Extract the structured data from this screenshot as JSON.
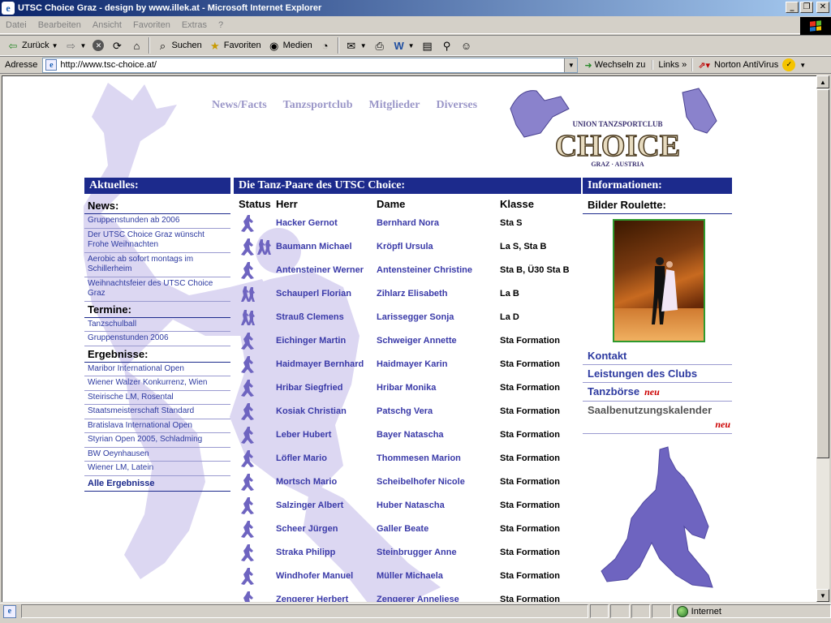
{
  "window": {
    "title": "UTSC Choice Graz - design by www.illek.at - Microsoft Internet Explorer",
    "minimize": "_",
    "restore": "❐",
    "close": "✕"
  },
  "menu": [
    "Datei",
    "Bearbeiten",
    "Ansicht",
    "Favoriten",
    "Extras",
    "?"
  ],
  "toolbar": {
    "back": "Zurück",
    "search": "Suchen",
    "favorites": "Favoriten",
    "media": "Medien"
  },
  "address": {
    "label": "Adresse",
    "url": "http://www.tsc-choice.at/",
    "go": "Wechseln zu",
    "links": "Links",
    "norton": "Norton AntiVirus"
  },
  "site": {
    "nav": [
      "News/Facts",
      "Tanzsportclub",
      "Mitglieder",
      "Diverses"
    ],
    "logo": {
      "top": "UNION TANZSPORTCLUB",
      "main": "CHOICE",
      "bottom": "GRAZ · AUSTRIA"
    },
    "left": {
      "heading": "Aktuelles:",
      "news_title": "News:",
      "news": [
        "Gruppenstunden ab 2006",
        "Der UTSC Choice Graz wünscht Frohe Weihnachten",
        "Aerobic ab sofort montags im Schillerheim",
        "Weihnachtsfeier des UTSC Choice Graz"
      ],
      "termine_title": "Termine:",
      "termine": [
        "Tanzschulball",
        "Gruppenstunden 2006"
      ],
      "ergebnisse_title": "Ergebnisse:",
      "ergebnisse": [
        "Maribor International Open",
        "Wiener Walzer Konkurrenz, Wien",
        "Steirische LM, Rosental",
        "Staatsmeisterschaft Standard",
        "Bratislava International Open",
        "Styrian Open 2005, Schladming",
        "BW Oeynhausen",
        "Wiener LM, Latein"
      ],
      "all_results": "Alle Ergebnisse"
    },
    "middle": {
      "heading": "Die Tanz-Paare des UTSC Choice:",
      "col_status": "Status",
      "col_herr": "Herr",
      "col_dame": "Dame",
      "col_klasse": "Klasse",
      "rows": [
        {
          "herr": "Hacker Gernot",
          "dame": "Bernhard Nora",
          "klasse": "Sta S",
          "icons": [
            "standard"
          ]
        },
        {
          "herr": "Baumann Michael",
          "dame": "Kröpfl Ursula",
          "klasse": "La S, Sta B",
          "icons": [
            "standard",
            "latin"
          ]
        },
        {
          "herr": "Antensteiner Werner",
          "dame": "Antensteiner Christine",
          "klasse": "Sta B, Ü30 Sta B",
          "icons": [
            "standard"
          ]
        },
        {
          "herr": "Schauperl Florian",
          "dame": "Zihlarz Elisabeth",
          "klasse": "La B",
          "icons": [
            "latin"
          ]
        },
        {
          "herr": "Strauß Clemens",
          "dame": "Larissegger Sonja",
          "klasse": "La D",
          "icons": [
            "latin"
          ]
        },
        {
          "herr": "Eichinger Martin",
          "dame": "Schweiger Annette",
          "klasse": "Sta Formation",
          "icons": [
            "standard"
          ]
        },
        {
          "herr": "Haidmayer Bernhard",
          "dame": "Haidmayer Karin",
          "klasse": "Sta Formation",
          "icons": [
            "standard"
          ]
        },
        {
          "herr": "Hribar Siegfried",
          "dame": "Hribar Monika",
          "klasse": "Sta Formation",
          "icons": [
            "standard"
          ]
        },
        {
          "herr": "Kosiak Christian",
          "dame": "Patschg Vera",
          "klasse": "Sta Formation",
          "icons": [
            "standard"
          ]
        },
        {
          "herr": "Leber Hubert",
          "dame": "Bayer Natascha",
          "klasse": "Sta Formation",
          "icons": [
            "standard"
          ]
        },
        {
          "herr": "Löfler Mario",
          "dame": "Thommesen Marion",
          "klasse": "Sta Formation",
          "icons": [
            "standard"
          ]
        },
        {
          "herr": "Mortsch Mario",
          "dame": "Scheibelhofer Nicole",
          "klasse": "Sta Formation",
          "icons": [
            "standard"
          ]
        },
        {
          "herr": "Salzinger Albert",
          "dame": "Huber Natascha",
          "klasse": "Sta Formation",
          "icons": [
            "standard"
          ]
        },
        {
          "herr": "Scheer Jürgen",
          "dame": "Galler Beate",
          "klasse": "Sta Formation",
          "icons": [
            "standard"
          ]
        },
        {
          "herr": "Straka Philipp",
          "dame": "Steinbrugger Anne",
          "klasse": "Sta Formation",
          "icons": [
            "standard"
          ]
        },
        {
          "herr": "Windhofer Manuel",
          "dame": "Müller Michaela",
          "klasse": "Sta Formation",
          "icons": [
            "standard"
          ]
        },
        {
          "herr": "Zengerer Herbert",
          "dame": "Zengerer Anneliese",
          "klasse": "Sta Formation",
          "icons": [
            "standard"
          ]
        }
      ]
    },
    "right": {
      "heading": "Informationen:",
      "roulette": "Bilder Roulette:",
      "links": [
        "Kontakt",
        "Leistungen des Clubs"
      ],
      "tanzboerse": "Tanzbörse",
      "saal": "Saalbenutzungskalender",
      "neu": "neu"
    }
  },
  "status": {
    "zone": "Internet"
  },
  "colors": {
    "header_blue": "#1c2a8c",
    "link_blue": "#3a3aa8",
    "dancer_purple": "#6e64c0",
    "watermark": "#d9d4f0",
    "neu_red": "#cc0000"
  }
}
